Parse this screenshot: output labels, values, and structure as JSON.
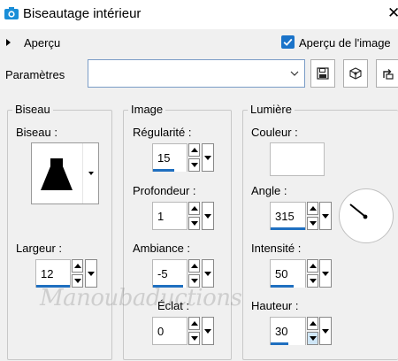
{
  "window": {
    "title": "Biseautage intérieur",
    "close_glyph": "✕"
  },
  "preview": {
    "label": "Aperçu",
    "image_preview_label": "Aperçu de l'image",
    "image_preview_checked": true
  },
  "params": {
    "label": "Paramètres",
    "preset_value": ""
  },
  "groups": {
    "bevel": {
      "title": "Biseau",
      "bevel_label": "Biseau :",
      "width_label": "Largeur :",
      "width_value": "12"
    },
    "image": {
      "title": "Image",
      "smoothness_label": "Régularité :",
      "smoothness_value": "15",
      "depth_label": "Profondeur :",
      "depth_value": "1",
      "ambience_label": "Ambiance :",
      "ambience_value": "-5",
      "shininess_label": "Éclat :",
      "shininess_value": "0"
    },
    "light": {
      "title": "Lumière",
      "color_label": "Couleur :",
      "color_value": "#ffffff",
      "angle_label": "Angle :",
      "angle_value": "315",
      "intensity_label": "Intensité :",
      "intensity_value": "50",
      "elevation_label": "Hauteur :",
      "elevation_value": "30"
    }
  },
  "watermark": "Manoubaductions",
  "colors": {
    "accent": "#1f6fc0",
    "checkbox": "#1a73c9",
    "background": "#f0f0f0"
  },
  "icons": [
    "camera-icon",
    "close-icon",
    "expand-caret-icon",
    "checkmark-icon",
    "chevron-down-icon",
    "save-icon",
    "preset-manager-icon",
    "reset-icon",
    "dropdown-arrow-icon",
    "spin-up-icon",
    "spin-down-icon"
  ]
}
